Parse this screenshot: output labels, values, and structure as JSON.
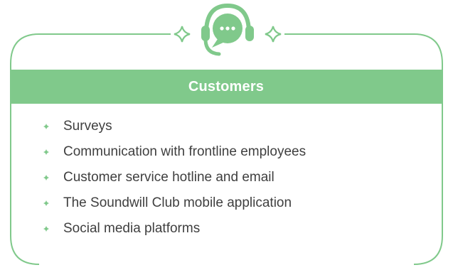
{
  "header": {
    "title": "Customers"
  },
  "items": [
    {
      "label": "Surveys"
    },
    {
      "label": "Communication with frontline employees"
    },
    {
      "label": "Customer service hotline and email"
    },
    {
      "label": "The Soundwill Club mobile application"
    },
    {
      "label": "Social media platforms"
    }
  ],
  "icons": {
    "center": "chat-support-headset-icon",
    "ornament": "sparkle-diamond-icon",
    "bullet": "sparkle-bullet-icon"
  },
  "colors": {
    "accent": "#80c98b",
    "text": "#3f3f3f",
    "header_text": "#ffffff"
  }
}
